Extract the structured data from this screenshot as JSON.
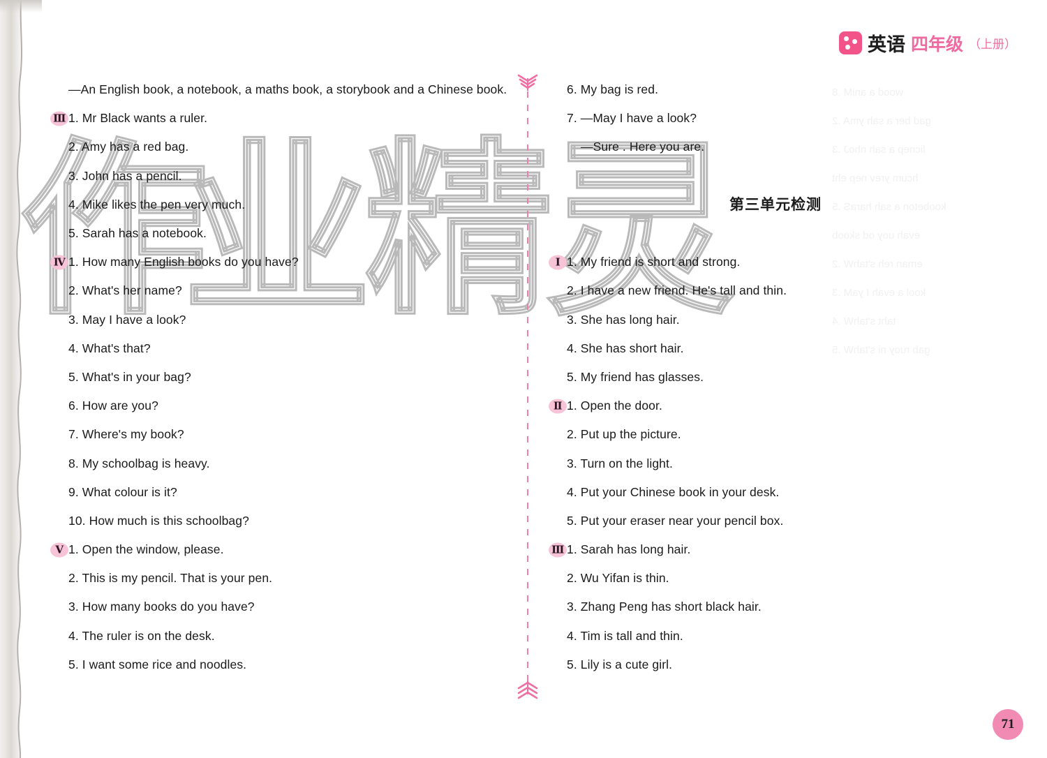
{
  "header": {
    "logo_icon": "dice-logo-icon",
    "subject": "英语",
    "grade": "四年级",
    "volume": "（上册）"
  },
  "watermark": {
    "chars": [
      "作",
      "业",
      "精",
      "灵"
    ]
  },
  "cutline": {
    "top_arrow_icon": "arrow-chevron-icon",
    "bottom_arrow_icon": "arrow-chevron-icon"
  },
  "unit_heading": "第三单元检测",
  "page_number": "71",
  "ghost_lines": [
    "wood a aniM .8",
    "gad ber a sah ymA .2",
    "licnep a sah nhoJ .3",
    "hcum yrev nep eht",
    "koobeton a sah haraS .5",
    "evah uoy od skoob",
    "eman reh s'tahW .2",
    "kool a evah I yaM .3",
    "taht s'tahW .4",
    "gab ruoy ni s'tahW .5"
  ],
  "left_column": [
    {
      "badge": "",
      "text": "—An English book, a notebook, a maths book, a storybook and a Chinese book."
    },
    {
      "badge": "Ⅲ",
      "text": "1. Mr Black wants a ruler."
    },
    {
      "badge": "",
      "text": "2. Amy has a red bag."
    },
    {
      "badge": "",
      "text": "3. John has a pencil."
    },
    {
      "badge": "",
      "text": "4. Mike likes the pen very much."
    },
    {
      "badge": "",
      "text": "5. Sarah has a notebook."
    },
    {
      "badge": "Ⅳ",
      "text": "1. How many English books do you have?"
    },
    {
      "badge": "",
      "text": "2. What's her name?"
    },
    {
      "badge": "",
      "text": "3. May I have a look?"
    },
    {
      "badge": "",
      "text": "4. What's that?"
    },
    {
      "badge": "",
      "text": "5. What's in your bag?"
    },
    {
      "badge": "",
      "text": "6. How are you?"
    },
    {
      "badge": "",
      "text": "7. Where's my book?"
    },
    {
      "badge": "",
      "text": "8. My schoolbag is heavy."
    },
    {
      "badge": "",
      "text": "9. What colour is it?"
    },
    {
      "badge": "",
      "text": "10. How much is this schoolbag?"
    },
    {
      "badge": "Ⅴ",
      "text": "1. Open the window, please."
    },
    {
      "badge": "",
      "text": "2. This is my pencil.  That is your pen."
    },
    {
      "badge": "",
      "text": "3. How many books do you have?"
    },
    {
      "badge": "",
      "text": "4. The ruler is on the desk."
    },
    {
      "badge": "",
      "text": "5. I want some rice and noodles."
    }
  ],
  "right_column": [
    {
      "badge": "",
      "text": "6. My bag is red.",
      "indent": false
    },
    {
      "badge": "",
      "text": "7.  —May I have a look?",
      "indent": false
    },
    {
      "badge": "",
      "text": "—Sure . Here you are.",
      "indent": true
    },
    {
      "badge": "",
      "text": "",
      "indent": false
    },
    {
      "badge": "",
      "text": "",
      "indent": false
    },
    {
      "badge": "",
      "text": "",
      "indent": false
    },
    {
      "badge": "Ⅰ",
      "text": "1. My friend is short and strong.",
      "indent": false
    },
    {
      "badge": "",
      "text": "2. I have a new friend. He's tall and thin.",
      "indent": false
    },
    {
      "badge": "",
      "text": "3. She has long hair.",
      "indent": false
    },
    {
      "badge": "",
      "text": "4. She has short hair.",
      "indent": false
    },
    {
      "badge": "",
      "text": "5. My friend has glasses.",
      "indent": false
    },
    {
      "badge": "Ⅱ",
      "text": "1. Open the door.",
      "indent": false
    },
    {
      "badge": "",
      "text": "2. Put up the picture.",
      "indent": false
    },
    {
      "badge": "",
      "text": "3. Turn on the light.",
      "indent": false
    },
    {
      "badge": "",
      "text": "4. Put your Chinese book in your desk.",
      "indent": false
    },
    {
      "badge": "",
      "text": "5. Put your eraser near your pencil box.",
      "indent": false
    },
    {
      "badge": "Ⅲ",
      "text": "1. Sarah has long hair.",
      "indent": false
    },
    {
      "badge": "",
      "text": "2. Wu Yifan is thin.",
      "indent": false
    },
    {
      "badge": "",
      "text": "3. Zhang Peng has short black hair.",
      "indent": false
    },
    {
      "badge": "",
      "text": "4. Tim is tall and thin.",
      "indent": false
    },
    {
      "badge": "",
      "text": "5. Lily is a cute girl.",
      "indent": false
    }
  ],
  "colors": {
    "accent_pink": "#f2548a",
    "badge_pink": "#f6c3d7",
    "cutline_pink": "#f07fae",
    "page_circle_pink": "#f28bb4",
    "watermark_grey": "#b9b9b9"
  }
}
